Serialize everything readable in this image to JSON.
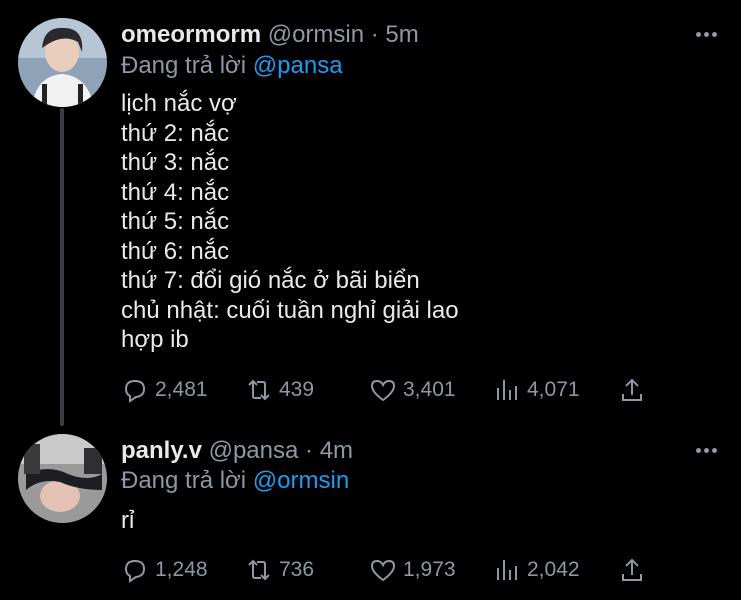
{
  "tweets": [
    {
      "name": "omeormorm",
      "handle": "@ormsin",
      "dot": "·",
      "time": "5m",
      "reply_prefix": "Đang trả lời",
      "reply_to": "@pansa",
      "lines": [
        "lịch nắc vợ",
        "thứ 2: nắc",
        "thứ 3: nắc",
        "thứ 4: nắc",
        "thứ 5: nắc",
        "thứ 6: nắc",
        "thứ 7: đổi gió nắc ở bãi biển",
        "chủ nhật: cuối tuần nghỉ giải lao",
        "hợp ib"
      ],
      "replies": "2,481",
      "retweets": "439",
      "likes": "3,401",
      "views": "4,071"
    },
    {
      "name": "panly.v",
      "handle": "@pansa",
      "dot": "·",
      "time": "4m",
      "reply_prefix": "Đang trả lời",
      "reply_to": "@ormsin",
      "lines": [
        "rỉ"
      ],
      "replies": "1,248",
      "retweets": "736",
      "likes": "1,973",
      "views": "2,042"
    }
  ],
  "icons": {
    "reply": "reply-icon",
    "retweet": "retweet-icon",
    "like": "heart-icon",
    "views": "views-icon",
    "share": "share-icon",
    "more": "more-icon"
  },
  "colors": {
    "background": "#000000",
    "text": "#e7e9ea",
    "muted": "#8b98a5",
    "link": "#1d9bf0"
  }
}
